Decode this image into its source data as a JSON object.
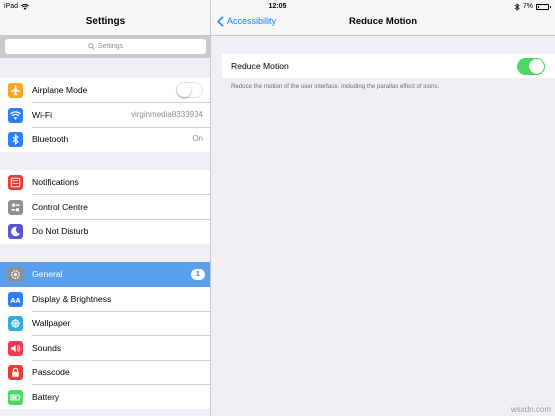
{
  "status_bar": {
    "device": "iPad",
    "time": "12:05",
    "battery": "7%",
    "battery_level": 0.07
  },
  "master": {
    "title": "Settings",
    "search_placeholder": "Settings",
    "groups": [
      [
        {
          "label": "Airplane Mode",
          "icon": "airplane-icon",
          "color": "#f5a623",
          "toggle": false
        },
        {
          "label": "Wi-Fi",
          "icon": "wifi-icon",
          "color": "#2d7ff9",
          "value": "virginmedia8333934"
        },
        {
          "label": "Bluetooth",
          "icon": "bluetooth-icon",
          "color": "#2d7ff9",
          "value": "On"
        }
      ],
      [
        {
          "label": "Notifications",
          "icon": "notifications-icon",
          "color": "#ee3b32"
        },
        {
          "label": "Control Centre",
          "icon": "control-centre-icon",
          "color": "#8e8e93"
        },
        {
          "label": "Do Not Disturb",
          "icon": "moon-icon",
          "color": "#5856d6"
        }
      ],
      [
        {
          "label": "General",
          "icon": "gear-icon",
          "color": "#8e8e93",
          "badge": "1",
          "selected": true
        },
        {
          "label": "Display & Brightness",
          "icon": "display-brightness-icon",
          "color": "#2d7ff9"
        },
        {
          "label": "Wallpaper",
          "icon": "wallpaper-icon",
          "color": "#35aadc"
        },
        {
          "label": "Sounds",
          "icon": "sound-icon",
          "color": "#ee3b52"
        },
        {
          "label": "Passcode",
          "icon": "lock-icon",
          "color": "#ee3b32"
        },
        {
          "label": "Battery",
          "icon": "battery-icon",
          "color": "#4cd964"
        }
      ]
    ]
  },
  "detail": {
    "back_label": "Accessibility",
    "title": "Reduce Motion",
    "setting_label": "Reduce Motion",
    "setting_on": true,
    "footnote": "Reduce the motion of the user interface, including the parallax effect of icons."
  },
  "watermark": "wsxdn.com"
}
